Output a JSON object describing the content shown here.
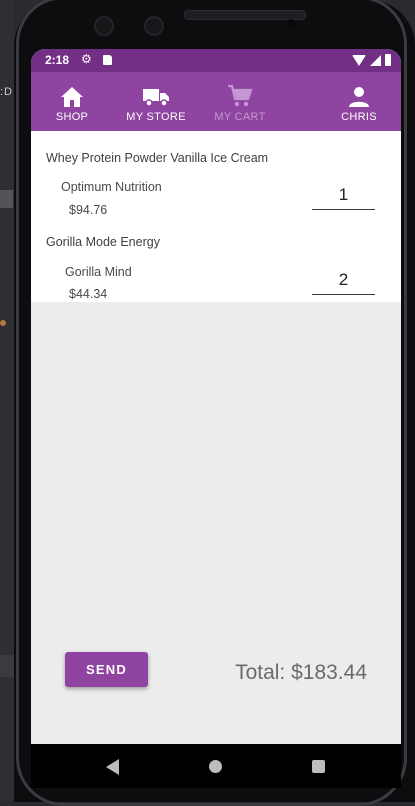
{
  "ide_sidebar": {
    "label": ":DI"
  },
  "status_bar": {
    "time": "2:18"
  },
  "nav": {
    "items": [
      {
        "label": "SHOP",
        "icon": "home-icon",
        "active": true
      },
      {
        "label": "MY STORE",
        "icon": "truck-icon",
        "active": true
      },
      {
        "label": "MY CART",
        "icon": "cart-icon",
        "active": false
      },
      {
        "label": "CHRIS",
        "icon": "person-icon",
        "active": true
      }
    ]
  },
  "cart": {
    "items": [
      {
        "name": "Whey Protein Powder Vanilla Ice Cream",
        "brand": "Optimum Nutrition",
        "price": "$94.76",
        "quantity": "1"
      },
      {
        "name": "Gorilla Mode Energy",
        "brand": "Gorilla Mind",
        "price": "$44.34",
        "quantity": "2"
      }
    ]
  },
  "footer": {
    "send_label": "SEND",
    "total": "Total: $183.44"
  },
  "colors": {
    "status_bar": "#732f86",
    "app_bar": "#8e44a0",
    "button": "#8e44a0",
    "background": "#ececec"
  }
}
